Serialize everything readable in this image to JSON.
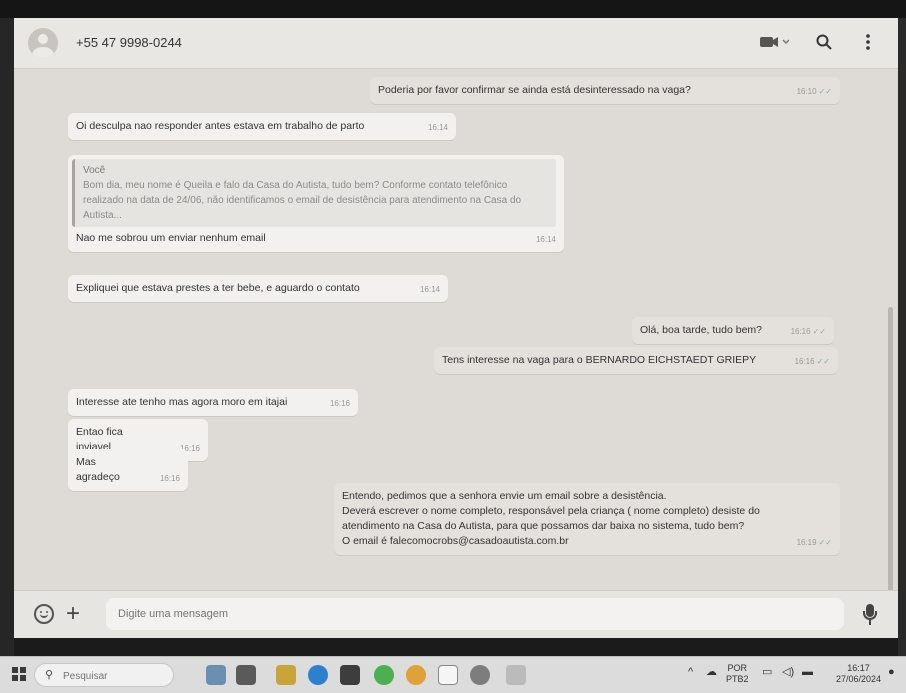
{
  "chat": {
    "contact_name": "+55 47 9998-0244",
    "messages": [
      {
        "id": "m1",
        "direction": "out",
        "text": "Poderia por favor confirmar se ainda está desinteressado na vaga?",
        "time": "16:10"
      },
      {
        "id": "m2",
        "direction": "in",
        "text": "Oi desculpa nao responder antes estava em trabalho de parto",
        "time": "16:14"
      },
      {
        "id": "m3",
        "direction": "in",
        "quote_author": "Você",
        "quote_text": "Bom dia, meu nome é Queila e falo da Casa do Autista, tudo bem? Conforme contato telefônico realizado na data de 24/06, não identificamos o email de desistência para atendimento na Casa do Autista...",
        "text": "Nao me sobrou um enviar nenhum email",
        "time": "16:14"
      },
      {
        "id": "m4",
        "direction": "in",
        "text": "Expliquei que estava prestes a ter bebe, e aguardo o contato",
        "time": "16:14"
      },
      {
        "id": "m5",
        "direction": "out",
        "text": "Olá, boa tarde, tudo bem?",
        "time": "16:16"
      },
      {
        "id": "m6",
        "direction": "out",
        "text": "Tens interesse na vaga para o BERNARDO EICHSTAEDT GRIEPY",
        "time": "16:16"
      },
      {
        "id": "m7",
        "direction": "in",
        "text": "Interesse ate tenho mas agora moro em itajai",
        "time": "16:16"
      },
      {
        "id": "m8",
        "direction": "in",
        "text": "Entao fica inviavel",
        "time": "16:16"
      },
      {
        "id": "m9",
        "direction": "in",
        "text": "Mas agradeço",
        "time": "16:16"
      },
      {
        "id": "m10",
        "direction": "out",
        "time": "16:19",
        "lines": [
          "Entendo, pedimos que a senhora envie um email sobre a desistência.",
          "Deverá escrever o nome completo, responsável pela criança ( nome completo) desiste do atendimento na Casa do Autista, para que possamos dar baixa no sistema, tudo bem?",
          "O email é falecomocrobs@casadoautista.com.br"
        ]
      }
    ],
    "composer_placeholder": "Digite uma mensagem"
  },
  "taskbar": {
    "search_placeholder": "Pesquisar",
    "lang_top": "POR",
    "lang_bottom": "PTB2",
    "time": "16:17",
    "date": "27/06/2024"
  },
  "icons": {
    "header": [
      "video-call-icon",
      "search-icon",
      "more-options-icon"
    ],
    "composer": [
      "emoji-icon",
      "attach-plus-icon",
      "microphone-icon"
    ]
  }
}
